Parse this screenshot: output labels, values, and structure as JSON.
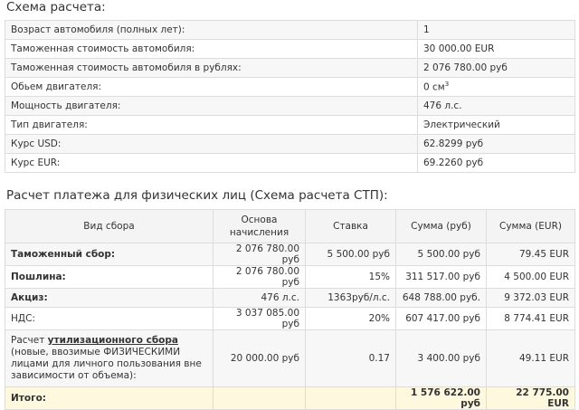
{
  "scheme": {
    "title": "Схема расчета:",
    "rows": [
      {
        "label": "Возраст автомобиля (полных лет):",
        "value": "1"
      },
      {
        "label": "Таможенная стоимость автомобиля:",
        "value": "30 000.00 EUR"
      },
      {
        "label": "Таможенная стоимость автомобиля в рублях:",
        "value": "2 076 780.00 руб"
      },
      {
        "label": "Обьем двигателя:",
        "value": "0 см"
      },
      {
        "label": "Мощность двигателя:",
        "value": "476 л.с."
      },
      {
        "label": "Тип двигателя:",
        "value": "Электрический"
      },
      {
        "label": "Курс USD:",
        "value": "62.8299 руб"
      },
      {
        "label": "Курс EUR:",
        "value": "69.2260 руб"
      }
    ],
    "volume_unit_sup": "3"
  },
  "payment": {
    "title": "Расчет платежа для физических лиц (Схема расчета СТП):",
    "headers": [
      "Вид сбора",
      "Основа начисления",
      "Ставка",
      "Сумма (руб)",
      "Сумма (EUR)"
    ],
    "rows": [
      {
        "name": "Таможенный сбор:",
        "base": "2 076 780.00 руб",
        "rate": "5 500.00 руб",
        "rub": "5 500.00 руб",
        "eur": "79.45 EUR"
      },
      {
        "name": "Пошлина:",
        "base": "2 076 780.00 руб",
        "rate": "15%",
        "rub": "311 517.00 руб",
        "eur": "4 500.00 EUR"
      },
      {
        "name": "Акциз:",
        "base": "476 л.с.",
        "rate": "1363руб/л.с.",
        "rub": "648 788.00 руб.",
        "eur": "9 372.03 EUR"
      },
      {
        "name": "НДС:",
        "base": "3 037 085.00 руб",
        "rate": "20%",
        "rub": "607 417.00 руб",
        "eur": "8 774.41 EUR"
      }
    ],
    "util": {
      "prefix": "Расчет ",
      "link": "утилизационного сбора",
      "suffix": " (новые, ввозимые ФИЗИЧЕСКИМИ лицами для личного пользования вне зависимости от объема):",
      "base": "20 000.00 руб",
      "rate": "0.17",
      "rub": "3 400.00 руб",
      "eur": "49.11 EUR"
    },
    "total": {
      "label": "Итого:",
      "rub": "1 576 622.00 руб",
      "eur": "22 775.00 EUR"
    }
  }
}
